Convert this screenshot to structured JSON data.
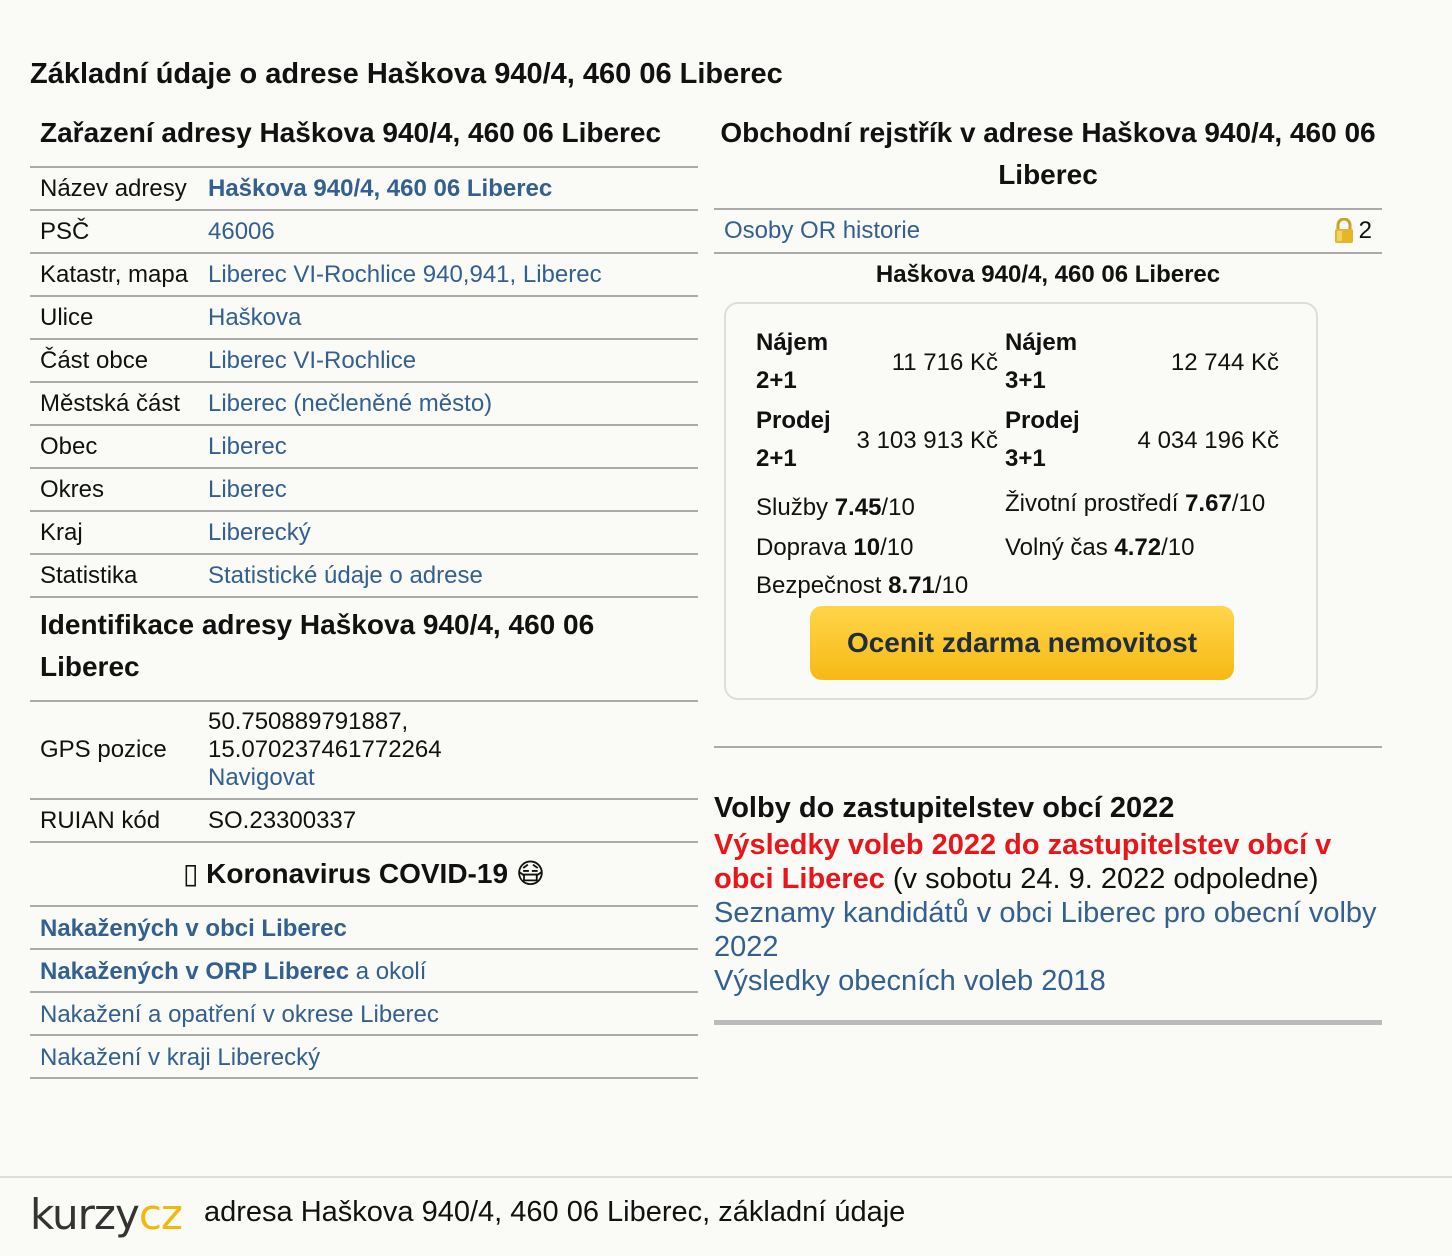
{
  "page_title": "Základní údaje o adrese Haškova 940/4, 460 06 Liberec",
  "zarazeni": {
    "title": "Zařazení adresy Haškova 940/4, 460 06 Liberec",
    "rows": [
      {
        "key": "Název adresy",
        "value": "Haškova 940/4, 460 06 Liberec"
      },
      {
        "key": "PSČ",
        "value": "46006"
      },
      {
        "key": "Katastr, mapa",
        "value": "Liberec VI-Rochlice 940,941, Liberec"
      },
      {
        "key": "Ulice",
        "value": "Haškova"
      },
      {
        "key": "Část obce",
        "value": "Liberec VI-Rochlice"
      },
      {
        "key": "Městská část",
        "value": "Liberec (nečleněné město)"
      },
      {
        "key": "Obec",
        "value": "Liberec"
      },
      {
        "key": "Okres",
        "value": "Liberec"
      },
      {
        "key": "Kraj",
        "value": "Liberecký"
      },
      {
        "key": "Statistika",
        "value": "Statistické údaje o adrese"
      }
    ]
  },
  "identifikace": {
    "title": "Identifikace adresy Haškova 940/4, 460 06 Liberec",
    "gps_key": "GPS pozice",
    "gps_lat": "50.750889791887,",
    "gps_lon": "15.070237461772264",
    "navigate": "Navigovat",
    "ruian_key": "RUIAN kód",
    "ruian_value": "SO.23300337"
  },
  "covid": {
    "title": "Koronavirus COVID-19",
    "title_prefix": "▯",
    "title_emoji": "😷",
    "links": [
      {
        "bold": "Nakažených v obci Liberec",
        "rest": ""
      },
      {
        "bold": "Nakažených v ORP Liberec",
        "rest": " a okolí"
      },
      {
        "bold": "",
        "rest": "Nakažení a opatření v okrese Liberec"
      },
      {
        "bold": "",
        "rest": "Nakažení v kraji Liberecký"
      }
    ]
  },
  "obchodni": {
    "title": "Obchodní rejstřík v adrese Haškova 940/4, 460 06 Liberec",
    "link": "Osoby OR historie",
    "lock_count": "2",
    "address": "Haškova 940/4, 460 06 Liberec"
  },
  "prices": {
    "najem_21_label1": "Nájem",
    "najem_21_label2": "2+1",
    "najem_21_value": "11 716 Kč",
    "najem_31_label1": "Nájem",
    "najem_31_label2": "3+1",
    "najem_31_value": "12 744 Kč",
    "prodej_21_label1": "Prodej",
    "prodej_21_label2": "2+1",
    "prodej_21_value": "3 103 913 Kč",
    "prodej_31_label1": "Prodej",
    "prodej_31_label2": "3+1",
    "prodej_31_value": "4 034 196 Kč",
    "scores": {
      "sluzby": {
        "label": "Služby ",
        "value": "7.45",
        "max": "/10"
      },
      "zivotni": {
        "label": "Životní prostředí ",
        "value": "7.67",
        "max": "/10"
      },
      "doprava": {
        "label": "Doprava ",
        "value": "10",
        "max": "/10"
      },
      "volny": {
        "label": "Volný čas ",
        "value": "4.72",
        "max": "/10"
      },
      "bezpecnost": {
        "label": "Bezpečnost ",
        "value": "8.71",
        "max": "/10"
      }
    },
    "cta": "Ocenit zdarma nemovitost"
  },
  "volby": {
    "title": "Volby do zastupitelstev obcí 2022",
    "red_link": "Výsledky voleb 2022 do zastupitelstev obcí v obci Liberec",
    "red_note": " (v sobotu 24. 9. 2022 odpoledne)",
    "link2": "Seznamy kandidátů v obci Liberec pro obecní volby 2022",
    "link3": "Výsledky obecních voleb 2018"
  },
  "footer": {
    "logo_a": "kurzy",
    "logo_b": "cz",
    "text": "adresa Haškova 940/4, 460 06 Liberec, základní údaje"
  },
  "colors": {
    "link": "#33608f",
    "red": "#e8161b",
    "cta": "#f6b915",
    "logo_accent": "#f0b90b"
  }
}
